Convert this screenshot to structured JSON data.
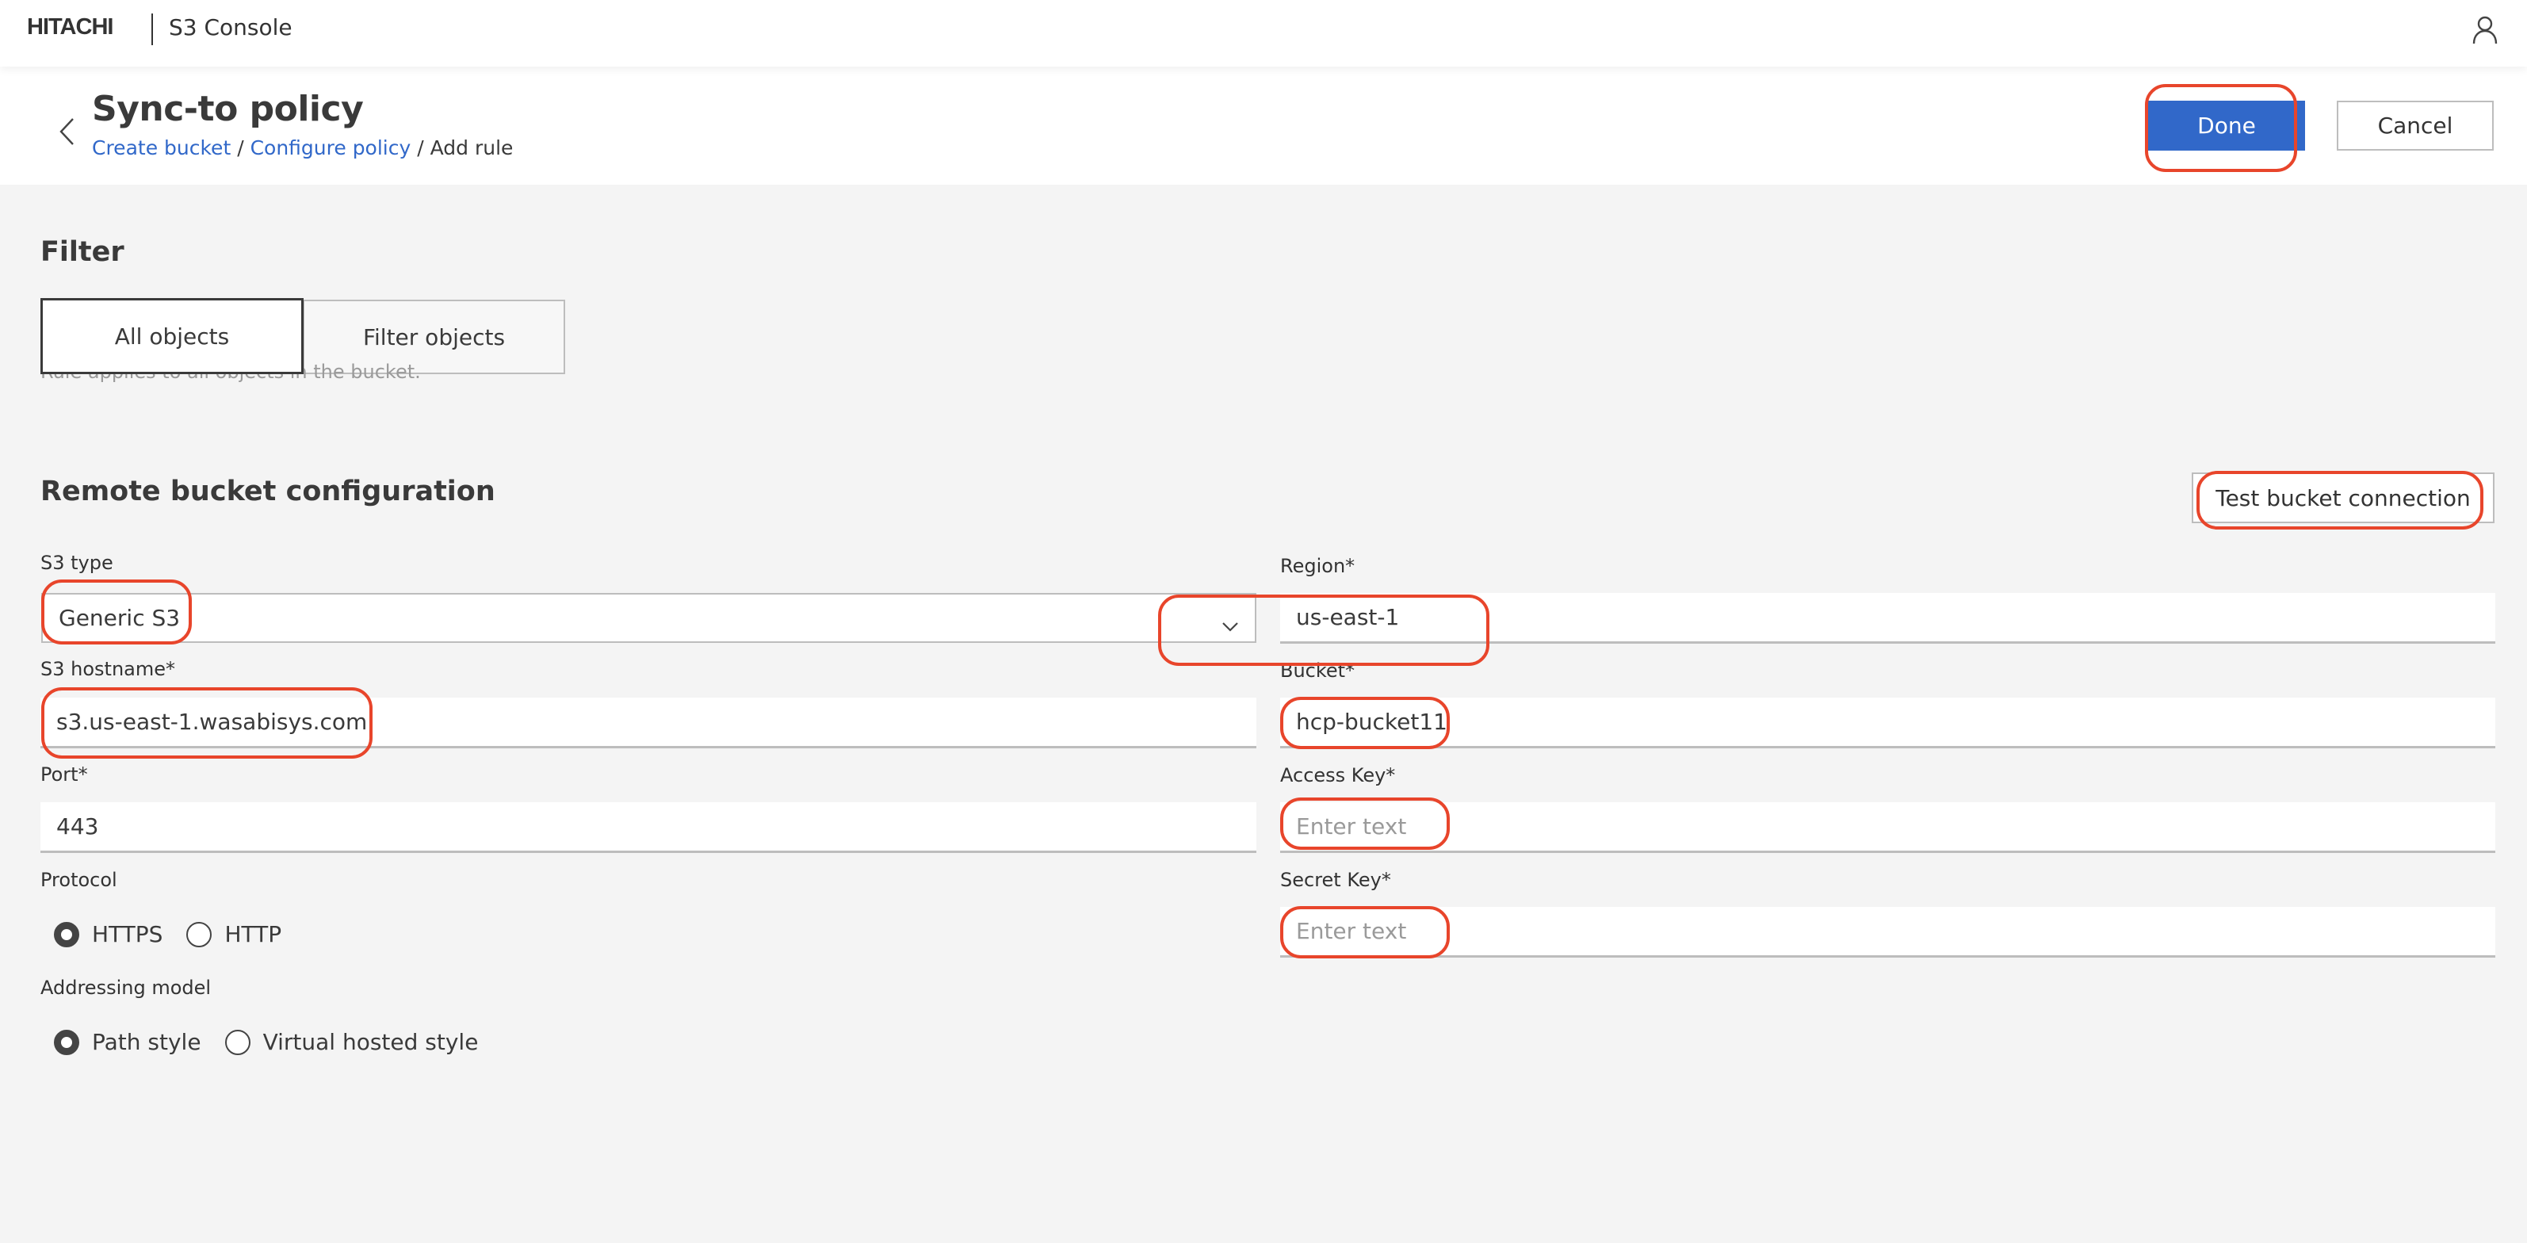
{
  "app": {
    "brand": "HITACHI",
    "name": "S3 Console",
    "user_icon": "user-icon"
  },
  "page": {
    "title": "Sync-to policy",
    "back_icon": "chevron-left-icon",
    "breadcrumb": [
      {
        "label": "Create bucket",
        "link": true
      },
      {
        "label": "Configure policy",
        "link": true
      },
      {
        "label": "Add rule",
        "link": false
      }
    ],
    "breadcrumb_separator": " / ",
    "actions": {
      "done_label": "Done",
      "cancel_label": "Cancel"
    }
  },
  "filter": {
    "title": "Filter",
    "options": [
      {
        "label": "All objects",
        "selected": true
      },
      {
        "label": "Filter objects",
        "selected": false
      }
    ],
    "hint": "Rule applies to all objects in the bucket."
  },
  "remote": {
    "title": "Remote bucket configuration",
    "test_button_label": "Test bucket connection",
    "s3_type": {
      "label": "S3 type",
      "value": "Generic S3"
    },
    "hostname": {
      "label": "S3 hostname*",
      "value": "s3.us-east-1.wasabisys.com"
    },
    "port": {
      "label": "Port*",
      "value": "443"
    },
    "protocol": {
      "label": "Protocol",
      "options": [
        {
          "label": "HTTPS",
          "checked": true
        },
        {
          "label": "HTTP",
          "checked": false
        }
      ]
    },
    "addressing": {
      "label": "Addressing model",
      "options": [
        {
          "label": "Path style",
          "checked": true
        },
        {
          "label": "Virtual hosted style",
          "checked": false
        }
      ]
    },
    "region": {
      "label": "Region*",
      "value": "us-east-1"
    },
    "bucket": {
      "label": "Bucket*",
      "value": "hcp-bucket11"
    },
    "access_key": {
      "label": "Access Key*",
      "value": "",
      "placeholder": "Enter text"
    },
    "secret_key": {
      "label": "Secret Key*",
      "value": "",
      "placeholder": "Enter text"
    }
  },
  "colors": {
    "primary": "#3168c9",
    "background": "#f4f4f4",
    "highlight": "#e8452b",
    "text": "#3a3a3a",
    "muted": "#9a9a9a",
    "border": "#bdbdbd"
  }
}
